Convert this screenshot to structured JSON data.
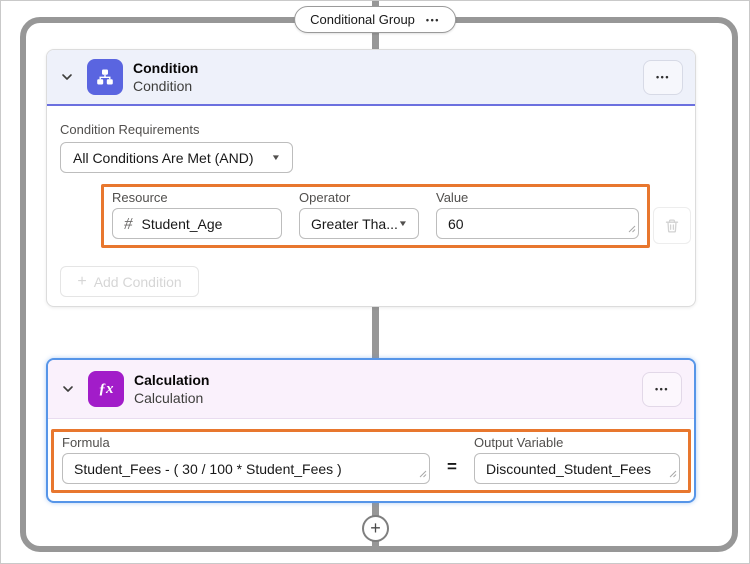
{
  "colors": {
    "group_connector": "#979797",
    "highlight_orange": "#e8772e",
    "condition_icon_bg": "#5a65e0",
    "condition_header_bg": "#eef1fa",
    "condition_header_accent": "#6b70df",
    "calculation_icon_bg": "#a21cc9",
    "calculation_header_bg": "#faf1fc",
    "selected_card_border": "#5695e8"
  },
  "group": {
    "label": "Conditional Group",
    "menu_glyph": "•••"
  },
  "condition_card": {
    "title": "Condition",
    "subtitle": "Condition",
    "menu_glyph": "•••",
    "requirements": {
      "label": "Condition Requirements",
      "value": "All Conditions Are Met (AND)",
      "caret_glyph": "▼"
    },
    "row": {
      "resource": {
        "label": "Resource",
        "icon_glyph": "#",
        "value": "Student_Age"
      },
      "operator": {
        "label": "Operator",
        "value": "Greater Tha...",
        "caret_glyph": "▼"
      },
      "value": {
        "label": "Value",
        "value": "60"
      }
    },
    "add_button": {
      "plus_glyph": "+",
      "label": "Add Condition"
    }
  },
  "calculation_card": {
    "title": "Calculation",
    "subtitle": "Calculation",
    "menu_glyph": "•••",
    "icon_glyph": "ƒx",
    "formula": {
      "label": "Formula",
      "value": "Student_Fees - ( 30 / 100 * Student_Fees )"
    },
    "equals_glyph": "=",
    "output": {
      "label": "Output Variable",
      "value": "Discounted_Student_Fees"
    }
  },
  "add_node": {
    "plus_glyph": "+"
  }
}
